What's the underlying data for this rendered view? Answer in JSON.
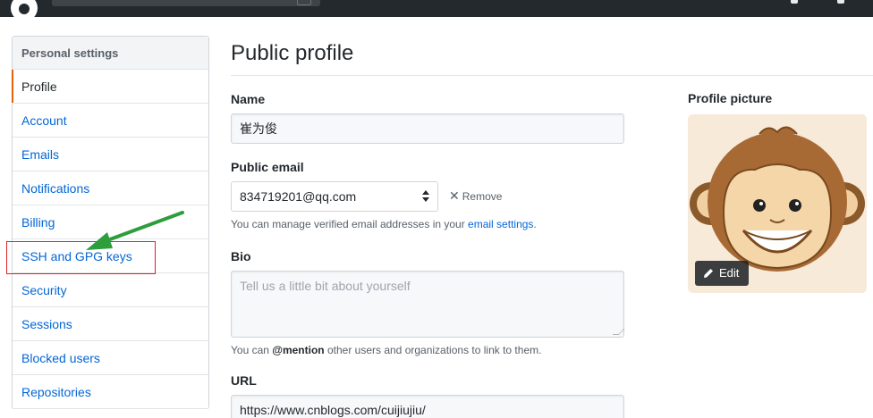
{
  "sidebar": {
    "header": "Personal settings",
    "items": [
      {
        "label": "Profile"
      },
      {
        "label": "Account"
      },
      {
        "label": "Emails"
      },
      {
        "label": "Notifications"
      },
      {
        "label": "Billing"
      },
      {
        "label": "SSH and GPG keys"
      },
      {
        "label": "Security"
      },
      {
        "label": "Sessions"
      },
      {
        "label": "Blocked users"
      },
      {
        "label": "Repositories"
      }
    ],
    "selected": "Profile"
  },
  "main": {
    "title": "Public profile",
    "name": {
      "label": "Name",
      "value": "崔为俊"
    },
    "public_email": {
      "label": "Public email",
      "value": "834719201@qq.com",
      "remove_label": "Remove",
      "note_prefix": "You can manage verified email addresses in your ",
      "note_link": "email settings",
      "note_suffix": "."
    },
    "bio": {
      "label": "Bio",
      "placeholder": "Tell us a little bit about yourself",
      "note_prefix": "You can ",
      "note_mention": "@mention",
      "note_suffix": " other users and organizations to link to them."
    },
    "url": {
      "label": "URL",
      "value": "https://www.cnblogs.com/cuijiujiu/"
    }
  },
  "profile_picture": {
    "label": "Profile picture",
    "edit_label": "Edit",
    "icon": "pencil-icon"
  },
  "colors": {
    "link": "#0366d6",
    "selected_marker": "#e36209",
    "annotation_box": "#e0212b",
    "annotation_arrow": "#2e9e3c"
  }
}
